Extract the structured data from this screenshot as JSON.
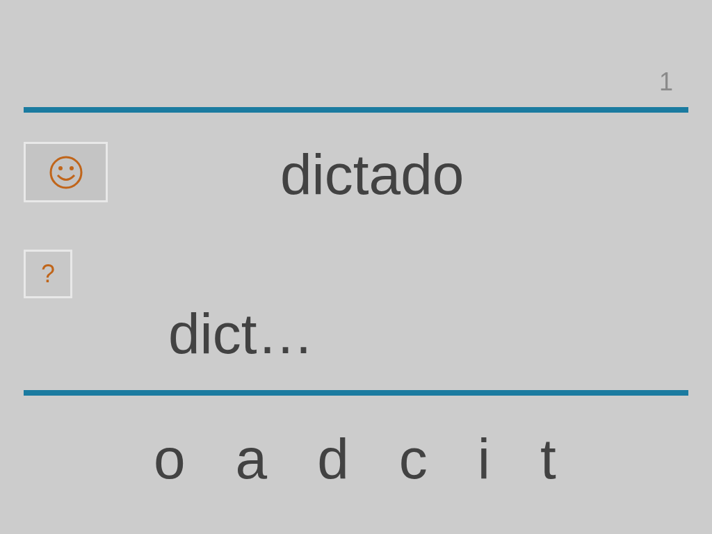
{
  "page_number": "1",
  "prompt": {
    "word": "dictado"
  },
  "hint_button": {
    "label": "?"
  },
  "answer": {
    "value": "dict…"
  },
  "letters": [
    "o",
    "a",
    "d",
    "c",
    "i",
    "t"
  ]
}
